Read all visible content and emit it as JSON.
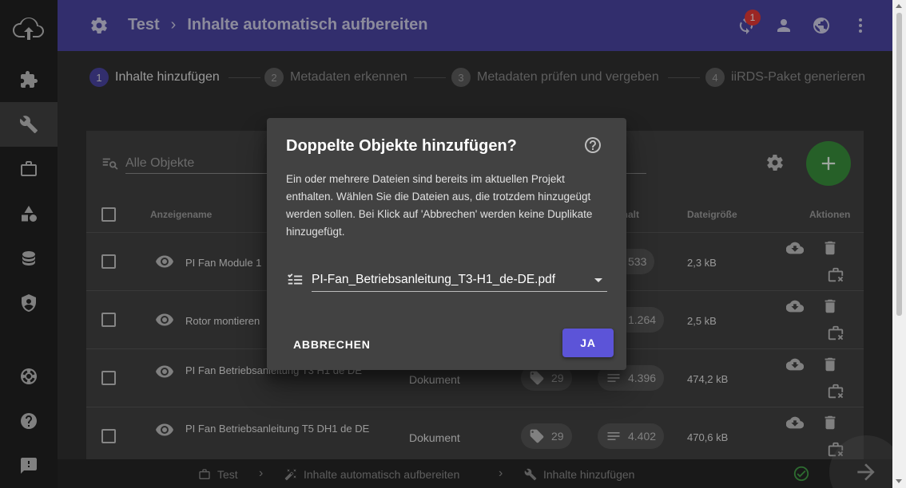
{
  "header": {
    "project": "Test",
    "separator": "›",
    "title": "Inhalte automatisch aufbereiten",
    "sync_badge": "1"
  },
  "stepper": [
    {
      "num": "1",
      "label": "Inhalte hinzufügen",
      "active": true
    },
    {
      "num": "2",
      "label": "Metadaten erkennen",
      "active": false
    },
    {
      "num": "3",
      "label": "Metadaten prüfen und vergeben",
      "active": false
    },
    {
      "num": "4",
      "label": "iiRDS-Paket generieren",
      "active": false
    }
  ],
  "search": {
    "placeholder": "Alle Objekte"
  },
  "table": {
    "headers": {
      "name": "Anzeigename",
      "content": "Inhalt",
      "size": "Dateigröße",
      "actions": "Aktionen"
    },
    "rows": [
      {
        "name": "PI Fan Module 1",
        "type": "",
        "tags": "",
        "content": "533",
        "size": "2,3 kB"
      },
      {
        "name": "Rotor montieren",
        "type": "",
        "tags": "",
        "content": "1.264",
        "size": "2,5 kB"
      },
      {
        "name": "PI Fan Betriebsanleitung T3 H1 de DE",
        "type": "Dokument",
        "tags": "29",
        "content": "4.396",
        "size": "474,2 kB"
      },
      {
        "name": "PI Fan Betriebsanleitung T5 DH1 de DE",
        "type": "Dokument",
        "tags": "29",
        "content": "4.402",
        "size": "470,6 kB"
      }
    ]
  },
  "footer": {
    "crumbs": [
      "Test",
      "Inhalte automatisch aufbereiten",
      "Inhalte hinzufügen"
    ],
    "separator": "›"
  },
  "dialog": {
    "title": "Doppelte Objekte hinzufügen?",
    "text": "Ein oder mehrere Dateien sind bereits im aktuellen Projekt enthalten. Wählen Sie die Dateien aus, die trotzdem hinzugeügt werden sollen. Bei Klick auf 'Abbrechen' werden keine Duplikate hinzugefügt.",
    "selected_file": "PI-Fan_Betriebsanleitung_T3-H1_de-DE.pdf",
    "cancel_label": "ABBRECHEN",
    "confirm_label": "JA"
  },
  "colors": {
    "header_bg": "#4b45a1",
    "accent": "#5c54d8",
    "fab": "#388e3c",
    "badge": "#e53935",
    "success": "#43a047"
  },
  "icons": [
    "cloud-upload-icon",
    "puzzle-icon",
    "wrench-icon",
    "briefcase-icon",
    "shapes-icon",
    "database-icon",
    "shield-icon",
    "lifebuoy-icon",
    "help-icon",
    "feedback-icon",
    "gear-icon",
    "sync-icon",
    "account-icon",
    "globe-icon",
    "more-vert-icon",
    "search-list-icon",
    "plus-icon",
    "eye-icon",
    "tag-icon",
    "text-lines-icon",
    "download-icon",
    "delete-icon",
    "remove-from-project-icon",
    "check-circle-icon",
    "arrow-right-icon",
    "help-circle-icon",
    "checklist-icon"
  ]
}
